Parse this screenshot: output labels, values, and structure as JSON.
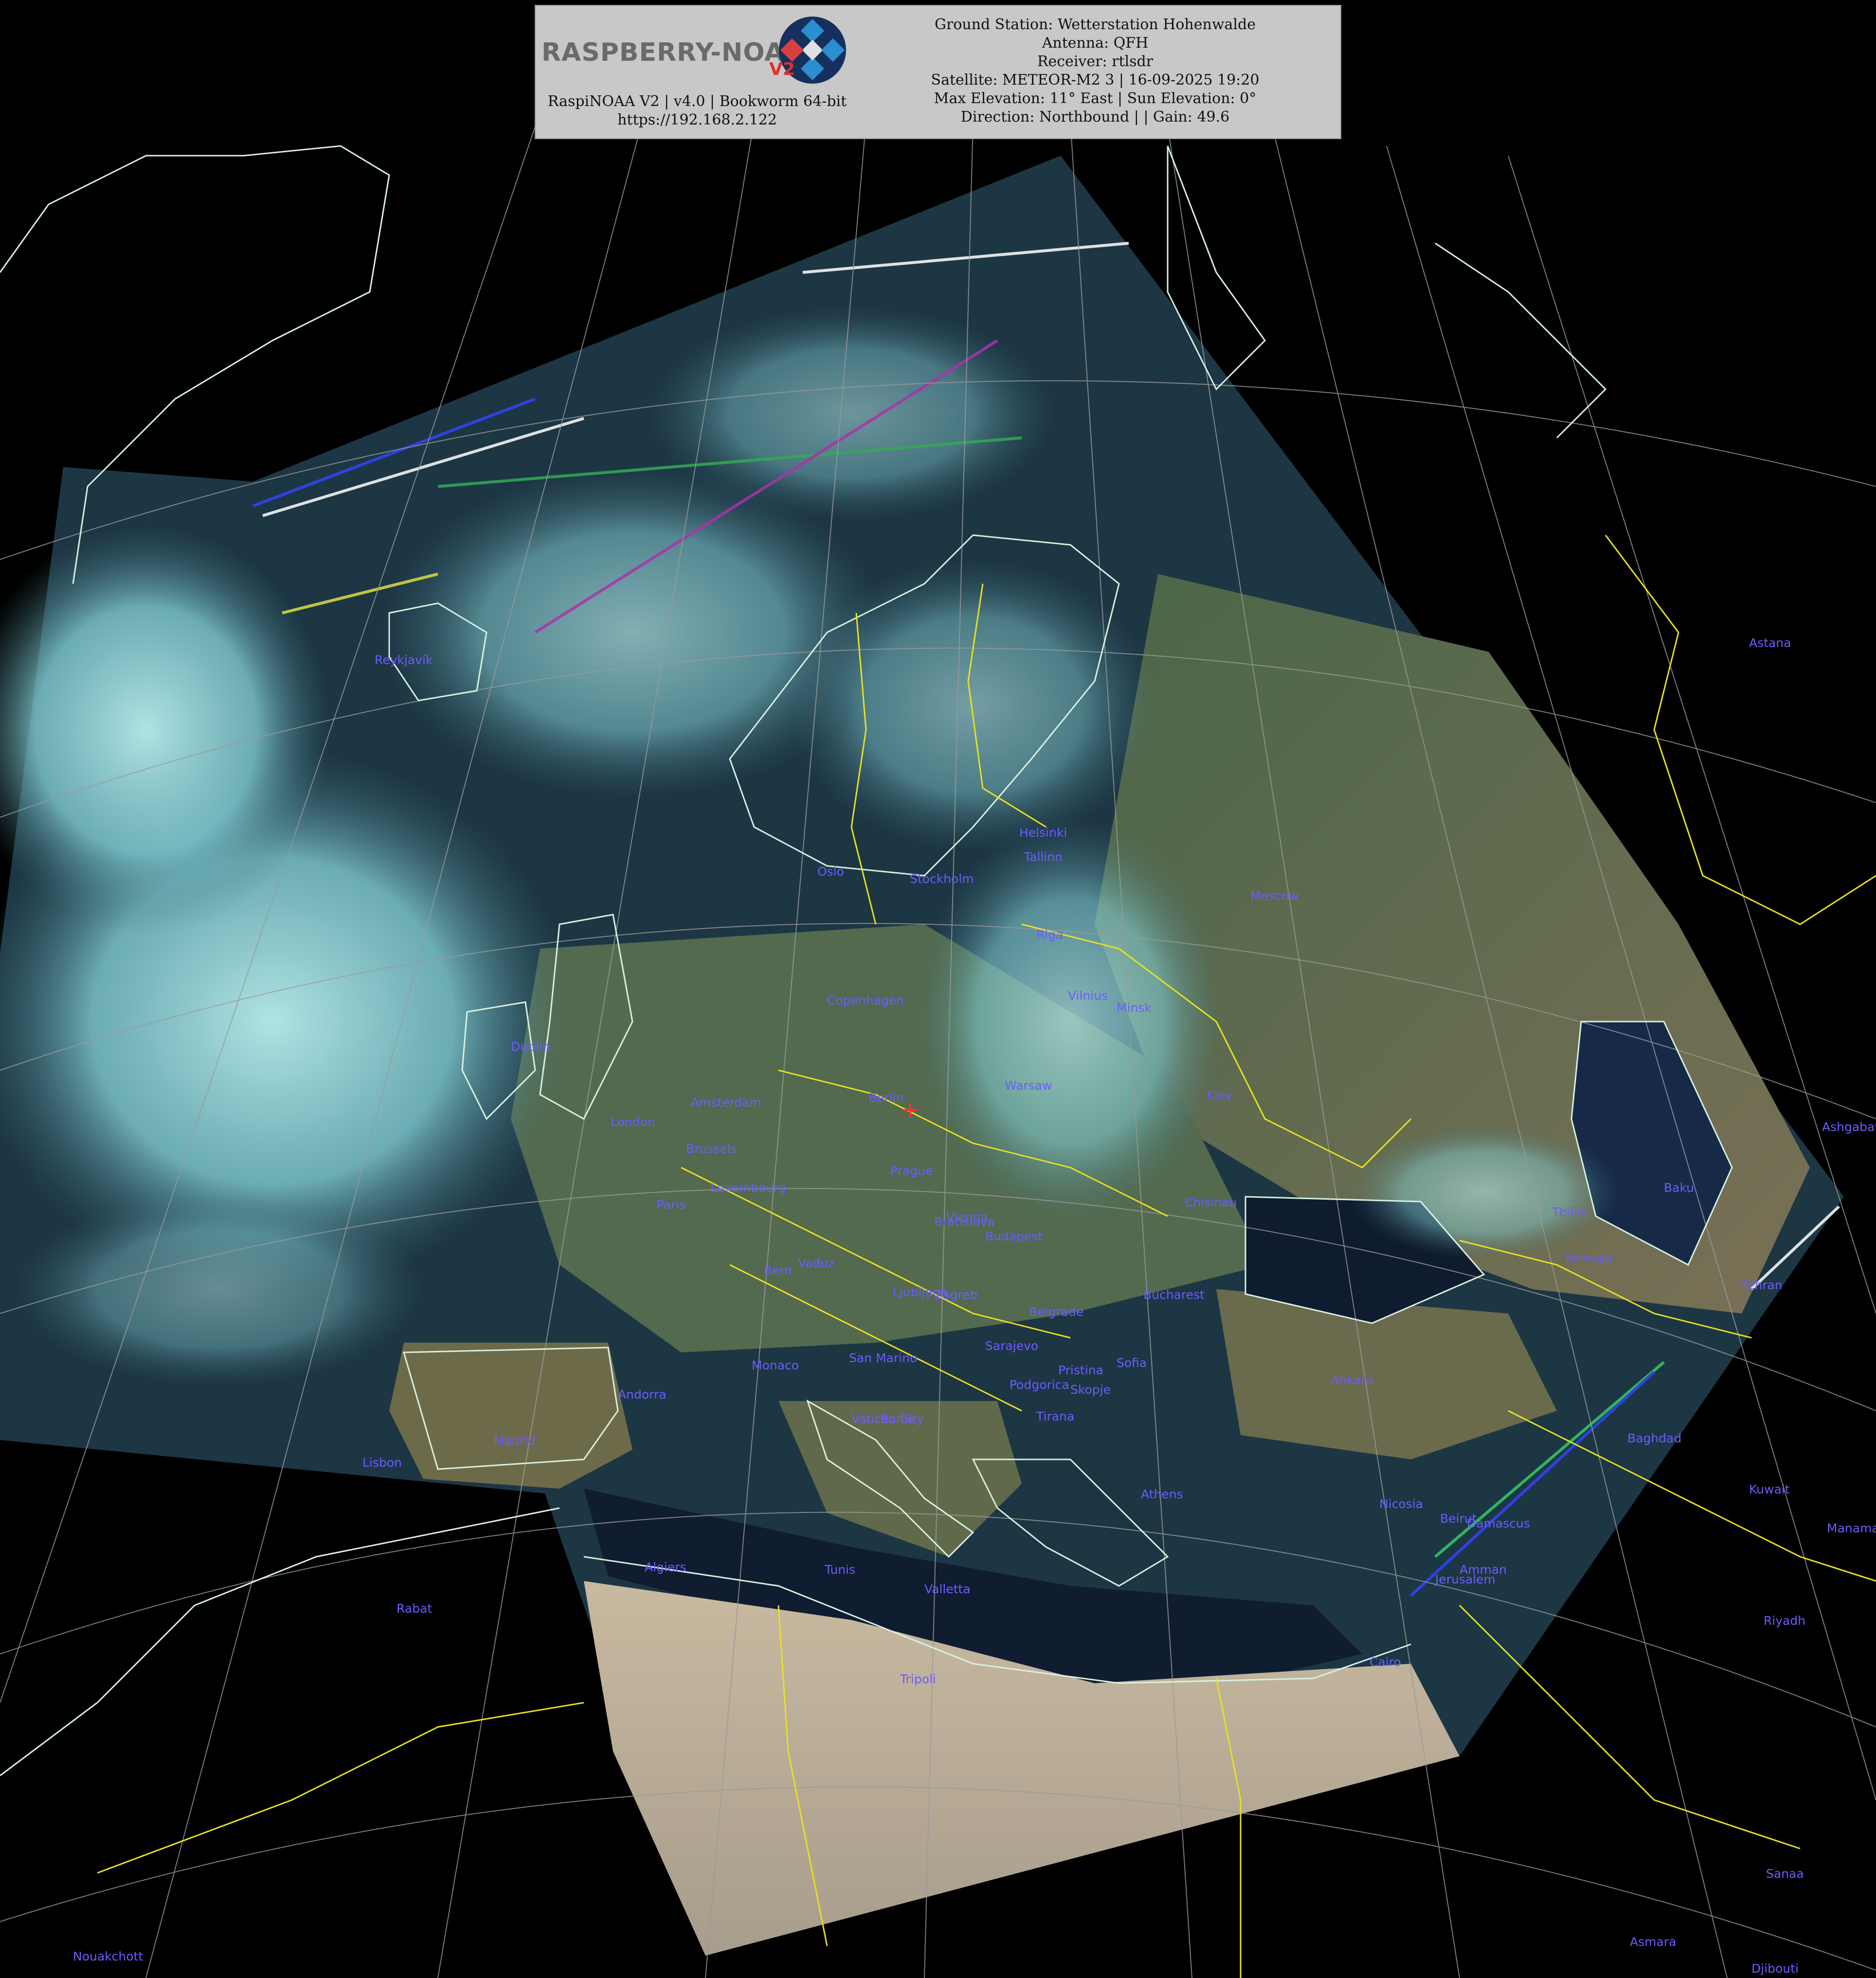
{
  "header": {
    "logo_text": "RASPBERRY-NOAA",
    "logo_version_badge": "V2",
    "software_line": "RaspiNOAA V2 | v4.0 | Bookworm 64-bit",
    "url": "https://192.168.2.122",
    "ground_station": "Ground Station: Wetterstation Hohenwalde",
    "antenna": "Antenna: QFH",
    "receiver": "Receiver: rtlsdr",
    "satellite": "Satellite: METEOR-M2 3 | 16-09-2025 19:20",
    "elevation": "Max Elevation: 11° East | Sun Elevation: 0°",
    "direction": "Direction: Northbound | | Gain: 49.6"
  },
  "map": {
    "colors": {
      "background": "#000000",
      "coastline": "#d8f0e0",
      "borders": "#e8e020",
      "graticule": "#9a9a9a",
      "city_label": "#6b5cff",
      "station_marker": "#ff3030",
      "cloud": "#9fdfe0",
      "land": "#4d6a4a",
      "sea": "#1a2a40",
      "desert": "#b9ae9a"
    },
    "station_marker_icon": "crosshair-icon",
    "cities": [
      "Reykjavík",
      "Oslo",
      "Stockholm",
      "Helsinki",
      "Tallinn",
      "Riga",
      "Moscow",
      "Vilnius",
      "Minsk",
      "Copenhagen",
      "Dublin",
      "London",
      "Amsterdam",
      "Berlin",
      "Brussels",
      "Luxembourg",
      "Paris",
      "Warsaw",
      "Prague",
      "Kiev",
      "Chisinau",
      "Vienna",
      "Bratislava",
      "Budapest",
      "Bern",
      "Vaduz",
      "Ljubljana",
      "Zagreb",
      "Bucharest",
      "Belgrade",
      "Sarajevo",
      "Monaco",
      "San Marino",
      "Pristina",
      "Sofia",
      "Podgorica",
      "Skopje",
      "Andorra",
      "Madrid",
      "Lisbon",
      "Vatican City",
      "Rome",
      "Tirana",
      "Athens",
      "Ankara",
      "Tbilisi",
      "Yerevan",
      "Baku",
      "Tehran",
      "Baghdad",
      "Kuwait",
      "Manama",
      "Nicosia",
      "Beirut",
      "Damascus",
      "Amman",
      "Jerusalem",
      "Riyadh",
      "Cairo",
      "Tripoli",
      "Valletta",
      "Tunis",
      "Algiers",
      "Rabat",
      "Nouakchott",
      "Sanaa",
      "Asmara",
      "Djibouti",
      "Astana",
      "Ashgabat"
    ]
  }
}
